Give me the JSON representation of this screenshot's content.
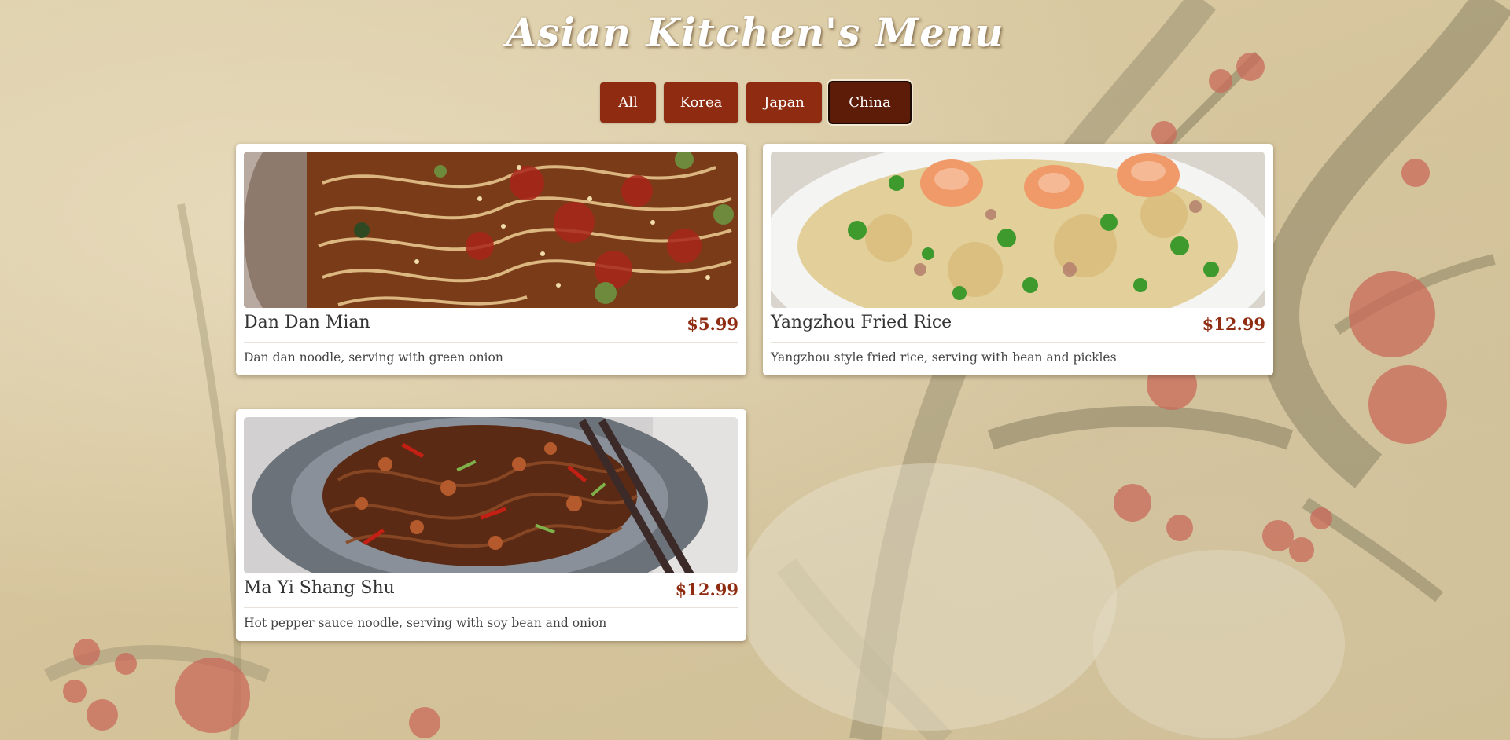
{
  "header": {
    "title": "Asian Kitchen's Menu"
  },
  "filters": [
    {
      "label": "All",
      "active": false
    },
    {
      "label": "Korea",
      "active": false
    },
    {
      "label": "Japan",
      "active": false
    },
    {
      "label": "China",
      "active": true
    }
  ],
  "menu": {
    "items": [
      {
        "name": "Dan Dan Mian",
        "price": "$5.99",
        "description": "Dan dan noodle, serving with green onion",
        "image": "dan-dan-mian-photo"
      },
      {
        "name": "Yangzhou Fried Rice",
        "price": "$12.99",
        "description": "Yangzhou style fried rice, serving with bean and pickles",
        "image": "yangzhou-fried-rice-photo"
      },
      {
        "name": "Ma Yi Shang Shu",
        "price": "$12.99",
        "description": "Hot pepper sauce noodle, serving with soy bean and onion",
        "image": "ma-yi-shang-shu-photo"
      }
    ]
  },
  "colors": {
    "button": "#8f2b10",
    "button_active": "#5c1c07",
    "price": "#8f2b10",
    "card": "#ffffff"
  }
}
